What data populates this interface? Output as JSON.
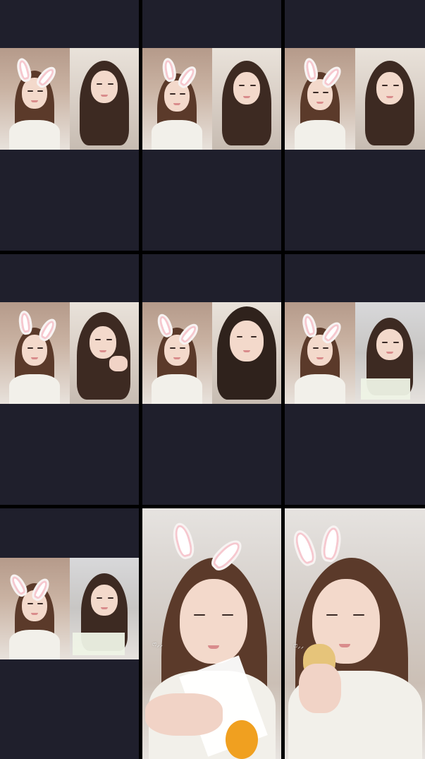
{
  "grid": {
    "rows": 3,
    "cols": 3,
    "tiles": [
      {
        "id": "tile-1",
        "type": "split",
        "right_variant": "dark-hair"
      },
      {
        "id": "tile-2",
        "type": "split",
        "right_variant": "dark-hair"
      },
      {
        "id": "tile-3",
        "type": "split",
        "right_variant": "dark-hair"
      },
      {
        "id": "tile-4",
        "type": "split",
        "right_variant": "dark-hair"
      },
      {
        "id": "tile-5",
        "type": "split",
        "right_variant": "dark-hair"
      },
      {
        "id": "tile-6",
        "type": "split",
        "right_variant": "light-room"
      },
      {
        "id": "tile-7",
        "type": "split",
        "right_variant": "light-room"
      },
      {
        "id": "tile-8",
        "type": "full",
        "item": "napkin-orange"
      },
      {
        "id": "tile-9",
        "type": "full",
        "item": "bun"
      }
    ]
  },
  "stickers": {
    "tile8": "ෆ̈⸝⸝",
    "tile9": "ෆ̈⸝⸝"
  },
  "colors": {
    "background": "#000000",
    "tile_empty": "#1f1f2c",
    "bunny_ear": "#ffffff",
    "bunny_inner": "#f6c8cf"
  },
  "icons": [
    "bunny-ears-filter"
  ]
}
